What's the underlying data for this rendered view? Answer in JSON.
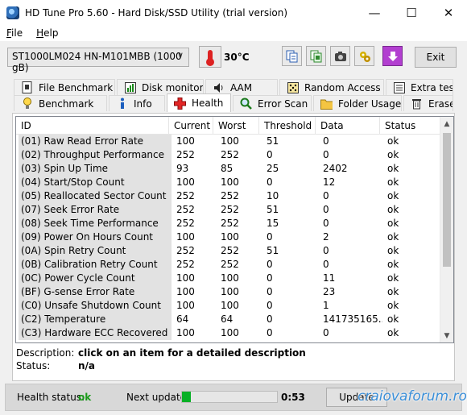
{
  "window": {
    "title": "HD Tune Pro 5.60 - Hard Disk/SSD Utility (trial version)"
  },
  "window_controls": {
    "minimize": "—",
    "maximize": "☐",
    "close": "✕"
  },
  "menu": [
    {
      "label": "File",
      "accel": "F",
      "rest": "ile"
    },
    {
      "label": "Help",
      "accel": "H",
      "rest": "elp"
    }
  ],
  "toolbar": {
    "drive": "ST1000LM024 HN-M101MBB (1000 gB)",
    "temperature": "30°C",
    "exit_label": "Exit"
  },
  "tabs_top": [
    "File Benchmark",
    "Disk monitor",
    "AAM",
    "Random Access",
    "Extra tests"
  ],
  "tabs_bottom": [
    "Benchmark",
    "Info",
    "Health",
    "Error Scan",
    "Folder Usage",
    "Erase"
  ],
  "active_tab": "Health",
  "table": {
    "columns": [
      "ID",
      "Current",
      "Worst",
      "Threshold",
      "Data",
      "Status"
    ],
    "rows": [
      [
        "(01) Raw Read Error Rate",
        "100",
        "100",
        "51",
        "0",
        "ok"
      ],
      [
        "(02) Throughput Performance",
        "252",
        "252",
        "0",
        "0",
        "ok"
      ],
      [
        "(03) Spin Up Time",
        "93",
        "85",
        "25",
        "2402",
        "ok"
      ],
      [
        "(04) Start/Stop Count",
        "100",
        "100",
        "0",
        "12",
        "ok"
      ],
      [
        "(05) Reallocated Sector Count",
        "252",
        "252",
        "10",
        "0",
        "ok"
      ],
      [
        "(07) Seek Error Rate",
        "252",
        "252",
        "51",
        "0",
        "ok"
      ],
      [
        "(08) Seek Time Performance",
        "252",
        "252",
        "15",
        "0",
        "ok"
      ],
      [
        "(09) Power On Hours Count",
        "100",
        "100",
        "0",
        "2",
        "ok"
      ],
      [
        "(0A) Spin Retry Count",
        "252",
        "252",
        "51",
        "0",
        "ok"
      ],
      [
        "(0B) Calibration Retry Count",
        "252",
        "252",
        "0",
        "0",
        "ok"
      ],
      [
        "(0C) Power Cycle Count",
        "100",
        "100",
        "0",
        "11",
        "ok"
      ],
      [
        "(BF) G-sense Error Rate",
        "100",
        "100",
        "0",
        "23",
        "ok"
      ],
      [
        "(C0) Unsafe Shutdown Count",
        "100",
        "100",
        "0",
        "1",
        "ok"
      ],
      [
        "(C2) Temperature",
        "64",
        "64",
        "0",
        "141735165...",
        "ok"
      ],
      [
        "(C3) Hardware ECC Recovered",
        "100",
        "100",
        "0",
        "0",
        "ok"
      ]
    ]
  },
  "description": {
    "desc_label": "Description:",
    "desc_value": "click on an item for a detailed description",
    "status_label": "Status:",
    "status_value": "n/a"
  },
  "status_bar": {
    "health_label": "Health status:",
    "health_value": "ok",
    "next_update_label": "Next update:",
    "next_update_progress": 0.09,
    "next_update_time": "0:53",
    "update_button": "Update",
    "watermark": "craiovaforum.ro"
  },
  "colors": {
    "health_ok": "#1a9a1a",
    "progress_fill": "#06b025",
    "watermark": "#3b8fd8"
  }
}
